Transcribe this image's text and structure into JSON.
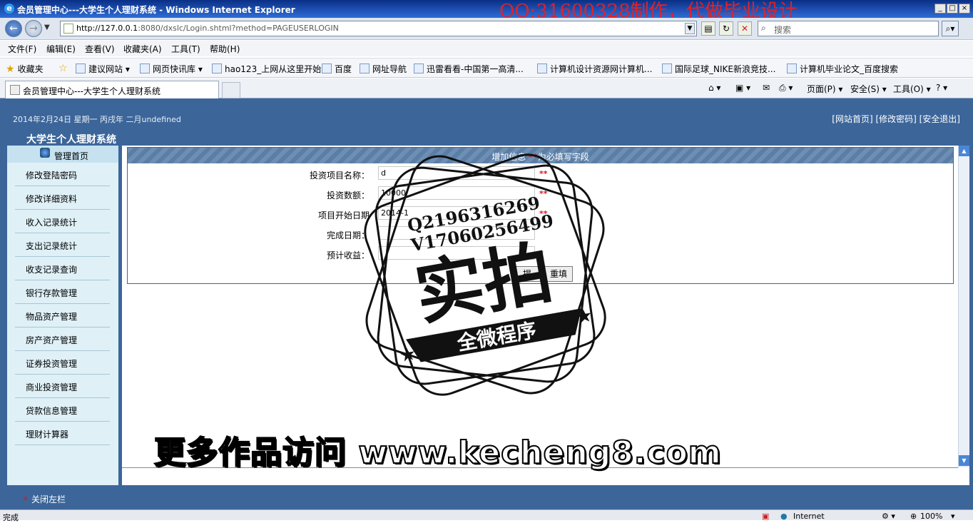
{
  "window": {
    "title": "会员管理中心---大学生个人理财系统 - Windows Internet Explorer",
    "overlay_watermark": "QQ:31600328制作，代做毕业设计",
    "controls": [
      "_",
      "□",
      "×"
    ]
  },
  "address_bar": {
    "url_host": "http://127.0.0.1",
    "url_rest": ":8080/dxslc/Login.shtml?method=PAGEUSERLOGIN",
    "search_placeholder": "搜索"
  },
  "menu": [
    "文件(F)",
    "编辑(E)",
    "查看(V)",
    "收藏夹(A)",
    "工具(T)",
    "帮助(H)"
  ],
  "favorites": {
    "label": "收藏夹",
    "items": [
      "建议网站 ▾",
      "网页快讯库 ▾",
      "hao123_上网从这里开始",
      "百度",
      "网址导航",
      "迅雷看看-中国第一高清...",
      "计算机设计资源网计算机...",
      "国际足球_NIKE新浪竞技...",
      "计算机毕业论文_百度搜索"
    ]
  },
  "tab": {
    "label": "会员管理中心---大学生个人理财系统"
  },
  "command_bar": [
    "页面(P) ▾",
    "安全(S) ▾",
    "工具(O) ▾",
    "? ▾"
  ],
  "header": {
    "date": "2014年2月24日 星期一 丙戌年 二月undefined",
    "links": "[网站首页] [修改密码] [安全退出]",
    "system_name": "大学生个人理财系统"
  },
  "sidebar": {
    "home": "管理首页",
    "items": [
      "修改登陆密码",
      "修改详细资料",
      "收入记录统计",
      "支出记录统计",
      "收支记录查询",
      "银行存款管理",
      "物品资产管理",
      "房产资产管理",
      "证券投资管理",
      "商业投资管理",
      "贷款信息管理",
      "理财计算器"
    ]
  },
  "form": {
    "header_text": "增加信息",
    "header_mark": "**",
    "header_note": "为必填写字段",
    "rows": [
      {
        "label": "投资项目名称：",
        "value": "d",
        "mark": "**"
      },
      {
        "label": "投资数额：",
        "value": "10000",
        "mark": "**"
      },
      {
        "label": "项目开始日期",
        "value": "2014-1",
        "mark": "**"
      },
      {
        "label": "完成日期：",
        "value": "",
        "mark": ""
      },
      {
        "label": "预计收益：",
        "value": "",
        "mark": "*"
      }
    ],
    "submit": "提",
    "reset": "重填"
  },
  "footer": {
    "close_mark": "×",
    "close_label": "关闭左栏"
  },
  "status": {
    "left": "完成",
    "zone": "Internet",
    "zoom": "100%"
  },
  "stamp": {
    "line1": "Q2196316269",
    "line2": "V17060256499",
    "big": "实拍",
    "banner": "全微程序"
  },
  "bottom_watermark": "更多作品访问 www.kecheng8.com",
  "colors": {
    "header_blue": "#3c669a",
    "sidebar_bg": "#dff0f7",
    "required_red": "#e3101a"
  }
}
